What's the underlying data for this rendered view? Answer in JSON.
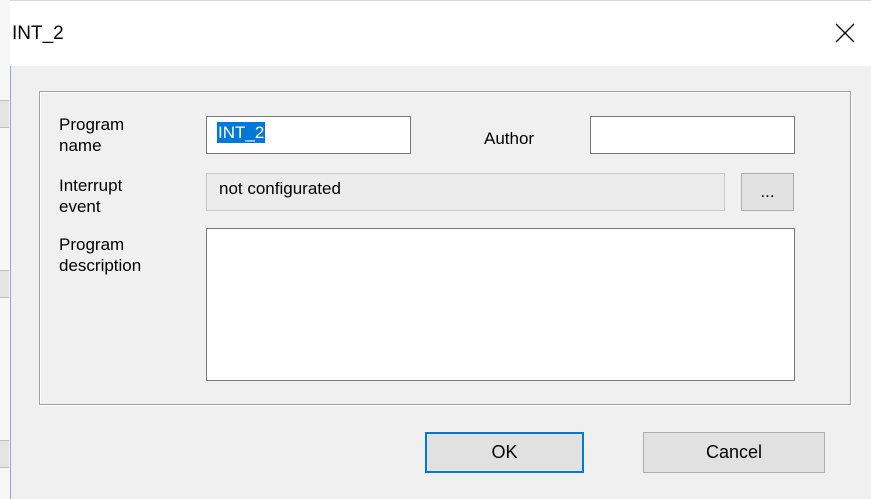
{
  "dialog": {
    "title": "INT_2",
    "close_icon": "close-icon"
  },
  "form": {
    "program_name_label_1": "Program",
    "program_name_label_2": "name",
    "program_name_value": "INT_2",
    "author_label": "Author",
    "author_value": "",
    "interrupt_event_label_1": "Interrupt",
    "interrupt_event_label_2": "event",
    "interrupt_event_value": "not configurated",
    "browse_label": "...",
    "program_description_label_1": "Program",
    "program_description_label_2": "description",
    "program_description_value": ""
  },
  "buttons": {
    "ok_label": "OK",
    "cancel_label": "Cancel"
  },
  "colors": {
    "selection": "#0078d7",
    "dialog_background": "#f0f0f0",
    "titlebar_background": "#ffffff"
  }
}
